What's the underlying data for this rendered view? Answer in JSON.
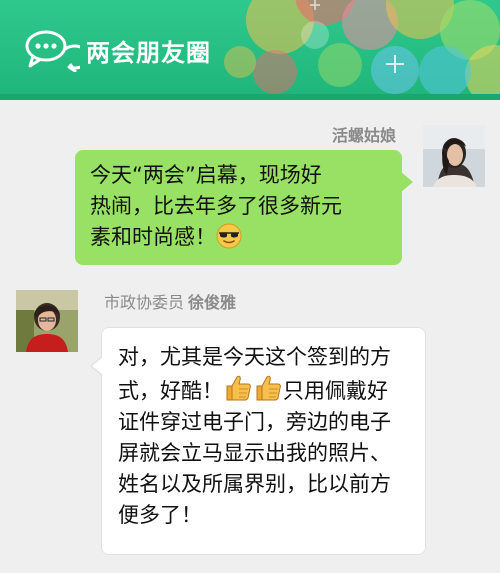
{
  "header": {
    "title": "两会朋友圈",
    "icon": "chat-bubbles-icon",
    "colors": {
      "background": "#22bb7e",
      "band": "#1aa66d"
    }
  },
  "messages": [
    {
      "side": "right",
      "sender": "活螺姑娘",
      "lines": [
        "今天“两会”启幕，现场好",
        "热闹，比去年多了很多新元",
        "素和时尚感！"
      ],
      "emoji": "sunglasses-emoji",
      "bubble_color": "#98e165"
    },
    {
      "side": "left",
      "sender_title": "市政协委员",
      "sender_name": "徐俊雅",
      "line1": "对，尤其是今天这个签到的方",
      "line2_before": "式，好酷！",
      "line2_after": "只用佩戴好",
      "line3": "证件穿过电子门，旁边的电子",
      "line4": "屏就会立马显示出我的照片、",
      "line5": "姓名以及所属界别，比以前方",
      "line6": "便多了！",
      "emoji": [
        "thumbs-up-emoji",
        "thumbs-up-emoji"
      ],
      "bubble_color": "#ffffff"
    }
  ]
}
